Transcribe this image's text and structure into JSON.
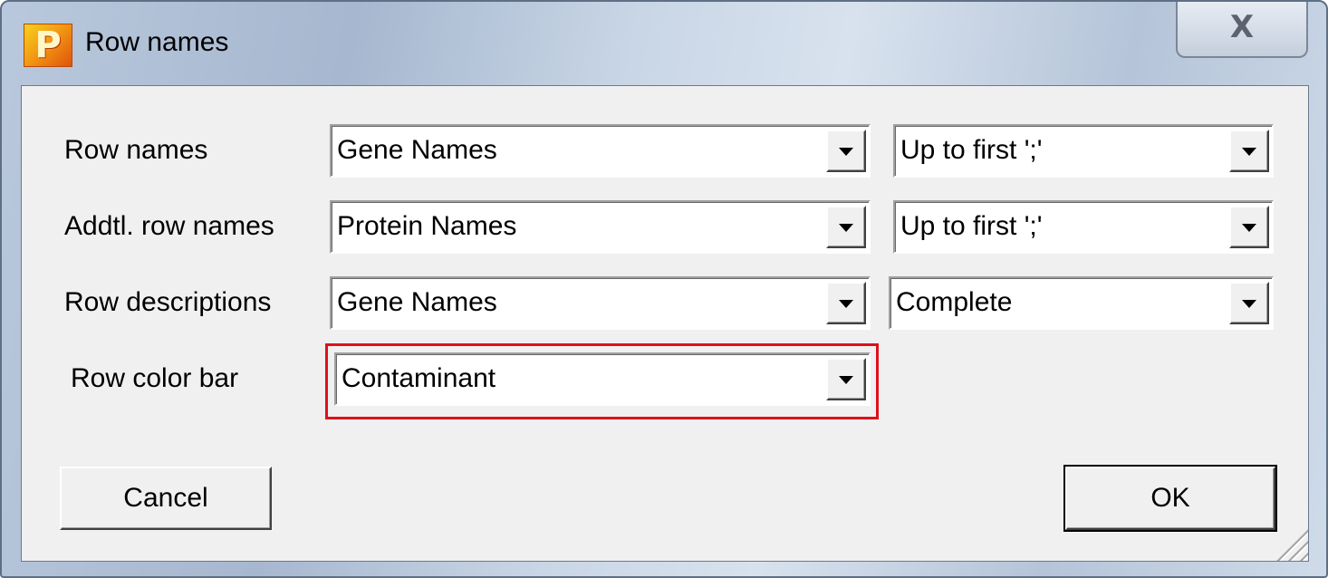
{
  "window": {
    "title": "Row names",
    "icon_letter": "P",
    "close_label": "X"
  },
  "rows": [
    {
      "label": "Row names",
      "source": "Gene Names",
      "mode": "Up to first ';'"
    },
    {
      "label": "Addtl. row names",
      "source": "Protein Names",
      "mode": "Up to first ';'"
    },
    {
      "label": "Row descriptions",
      "source": "Gene Names",
      "mode": "Complete"
    },
    {
      "label": "Row color bar",
      "source": "Contaminant"
    }
  ],
  "buttons": {
    "cancel_label": "Cancel",
    "ok_label": "OK"
  },
  "colors": {
    "highlight": "#e0101a",
    "dialog_background": "#f0f0f0"
  }
}
